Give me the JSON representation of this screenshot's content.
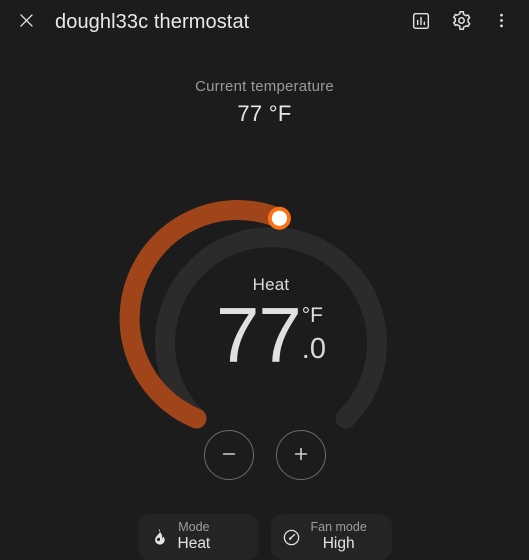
{
  "header": {
    "close_icon": "close-icon",
    "title": "doughl33c thermostat",
    "history_icon": "bar-chart-icon",
    "settings_icon": "gear-icon",
    "overflow_icon": "more-vertical-icon"
  },
  "current": {
    "label": "Current temperature",
    "value": "77 °F"
  },
  "dial": {
    "mode_label": "Heat",
    "target_integer": "77",
    "target_fraction": ".0",
    "unit": "°F",
    "active_color": "#a0451a",
    "track_color": "#2b2b2b",
    "handle_ring_color": "#f97316",
    "handle_fill_color": "#ffffff",
    "min": 45,
    "max": 95,
    "target_value": 77.0
  },
  "steppers": {
    "decrease_label": "−",
    "decrease_icon": "minus-icon",
    "increase_label": "+",
    "increase_icon": "plus-icon"
  },
  "bottom": {
    "mode": {
      "icon": "flame-icon",
      "label": "Mode",
      "value": "Heat"
    },
    "fan_mode": {
      "icon": "gauge-icon",
      "label": "Fan mode",
      "value": "High"
    }
  }
}
